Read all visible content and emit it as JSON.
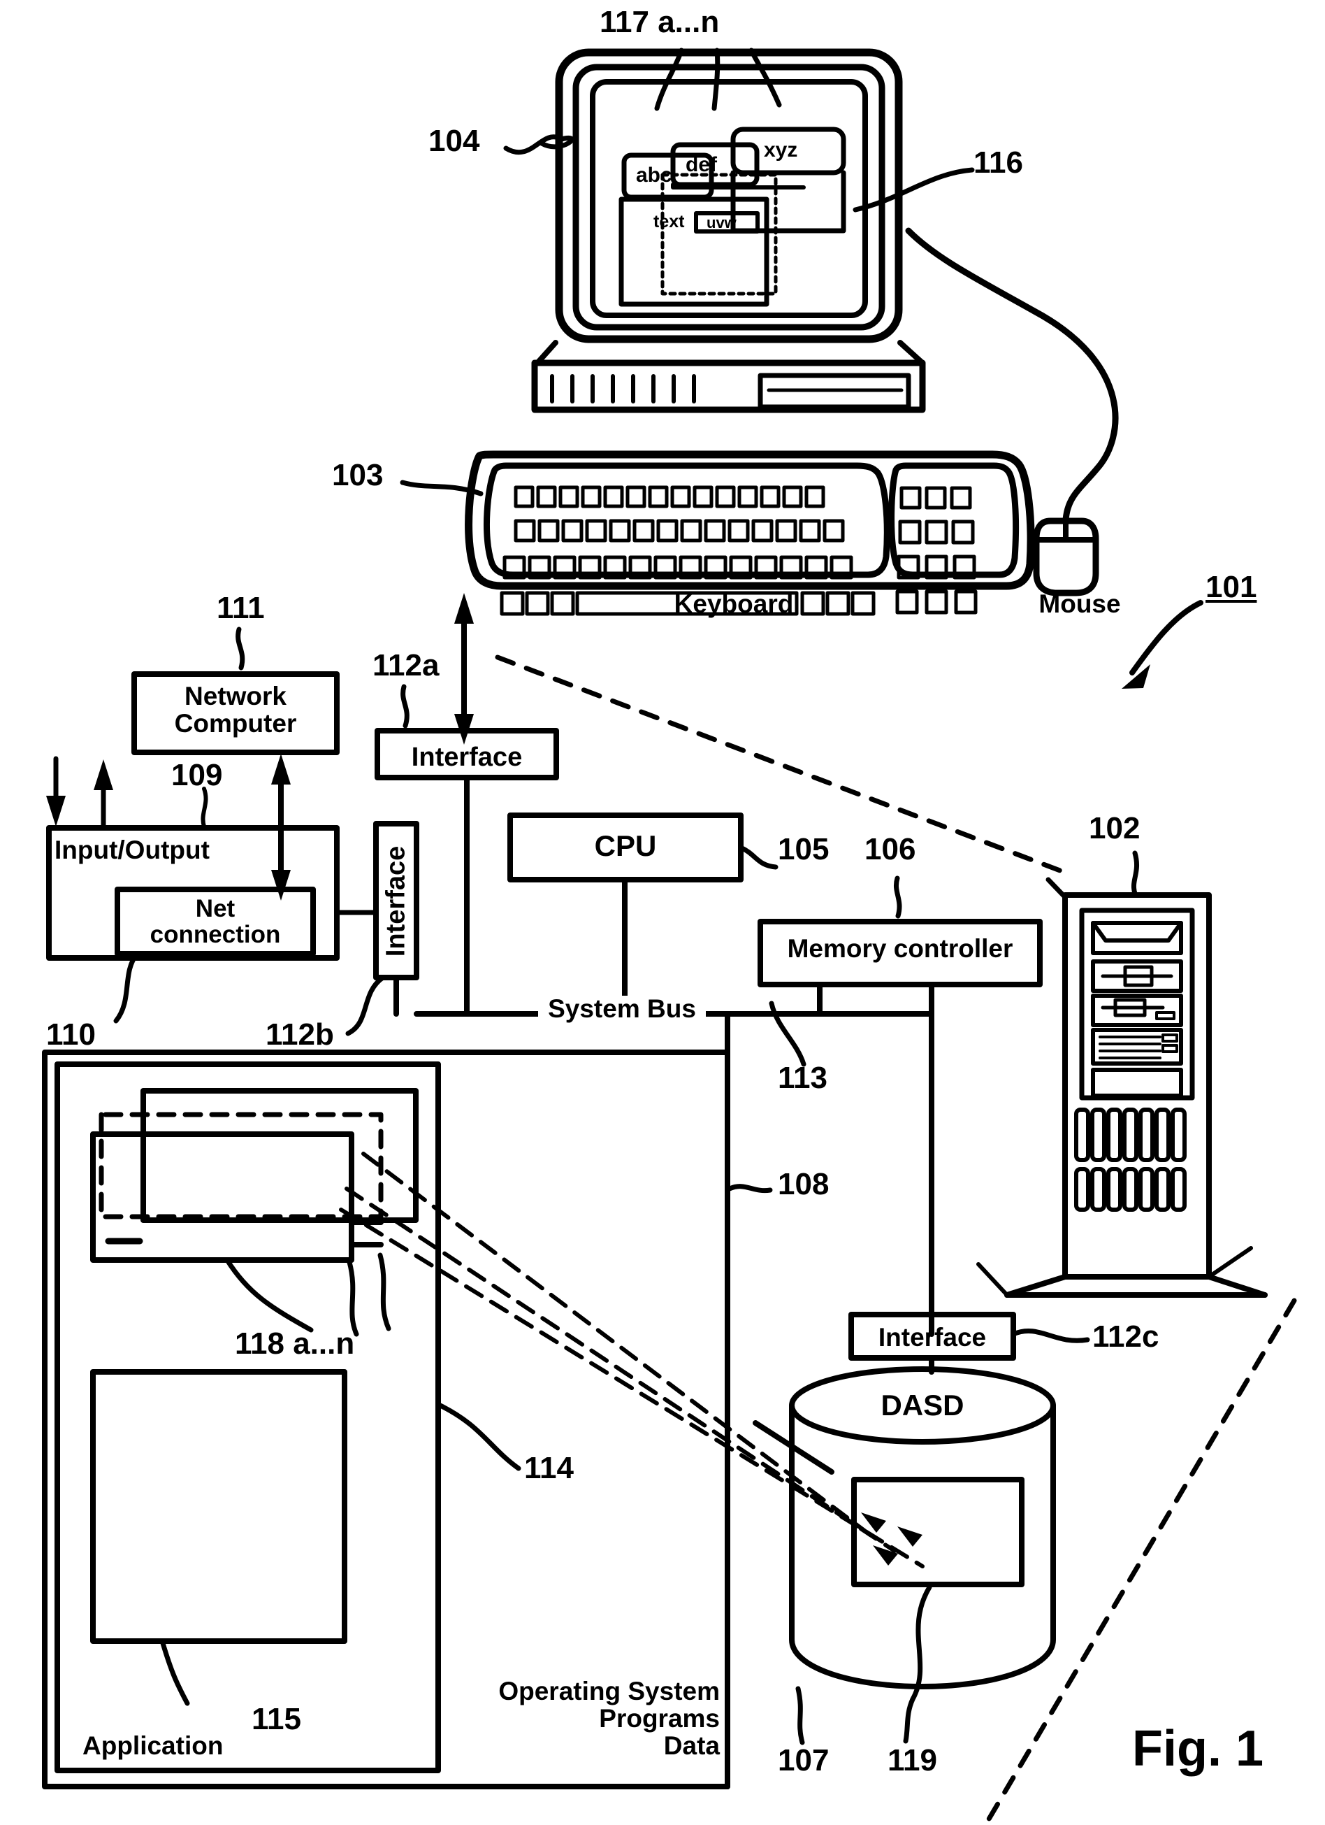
{
  "figure": {
    "title": "Fig. 1",
    "domain": "patent-diagram"
  },
  "screen_windows": {
    "tab_abc": "abc",
    "tab_def": "def",
    "tab_xyz": "xyz",
    "text_label": "text",
    "text_field_value": "uvw"
  },
  "labels": {
    "keyboard": "Keyboard",
    "mouse": "Mouse",
    "network_computer": "Network\nComputer",
    "network_computer_line1": "Network",
    "network_computer_line2": "Computer",
    "input_output": "Input/Output",
    "net_connection_line1": "Net",
    "net_connection_line2": "connection",
    "interface_a": "Interface",
    "interface_b": "Interface",
    "interface_c": "Interface",
    "cpu": "CPU",
    "memory_controller": "Memory controller",
    "system_bus": "System Bus",
    "dasd": "DASD",
    "application": "Application",
    "os_line1": "Operating System",
    "os_line2": "Programs",
    "os_line3": "Data"
  },
  "reference_numerals": {
    "n101": "101",
    "n102": "102",
    "n103": "103",
    "n104": "104",
    "n105": "105",
    "n106": "106",
    "n107": "107",
    "n108": "108",
    "n109": "109",
    "n110": "110",
    "n111": "111",
    "n112a": "112a",
    "n112b": "112b",
    "n112c": "112c",
    "n113": "113",
    "n114": "114",
    "n115": "115",
    "n116": "116",
    "n117": "117 a...n",
    "n118": "118 a...n",
    "n119": "119"
  },
  "colors": {
    "ink": "#000000",
    "paper": "#ffffff"
  }
}
